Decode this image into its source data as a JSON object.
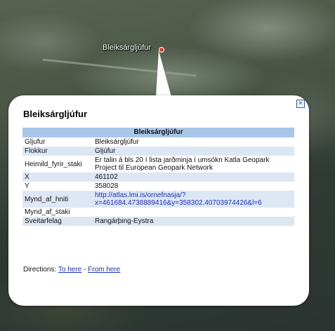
{
  "map": {
    "marker_label": "Bleiksárgljúfur"
  },
  "popup": {
    "title": "Bleiksárgljúfur",
    "close_icon": "close-icon",
    "table_header": "Bleiksárgljúfur",
    "rows": [
      {
        "key": "Gljufur",
        "value": "Bleiksárgljúfur"
      },
      {
        "key": "Flokkur",
        "value": "Gljúfur"
      },
      {
        "key": "Heimild_fyrir_staki",
        "value": "Er talin á bls 20 í lista jarðminja í umsókn Katla Geopark Project til European Geopark Network"
      },
      {
        "key": "X",
        "value": "461102"
      },
      {
        "key": "Y",
        "value": "358028"
      },
      {
        "key": "Mynd_af_hniti",
        "value": "http://atlas.lmi.is/ornefnasja/?x=461684.4738889416&y=358302.40703974426&l=6"
      },
      {
        "key": "Mynd_af_staki",
        "value": ""
      },
      {
        "key": "Sveitarfelag",
        "value": "Rangárþing-Eystra"
      }
    ],
    "link_line1": "http://atlas.lmi.is/ornefnasja/?",
    "link_line2": "x=461684.4738889416&y=358302.40703974426&l=6",
    "directions_label": "Directions:",
    "to_here": "To here",
    "separator": "-",
    "from_here": "From here"
  }
}
